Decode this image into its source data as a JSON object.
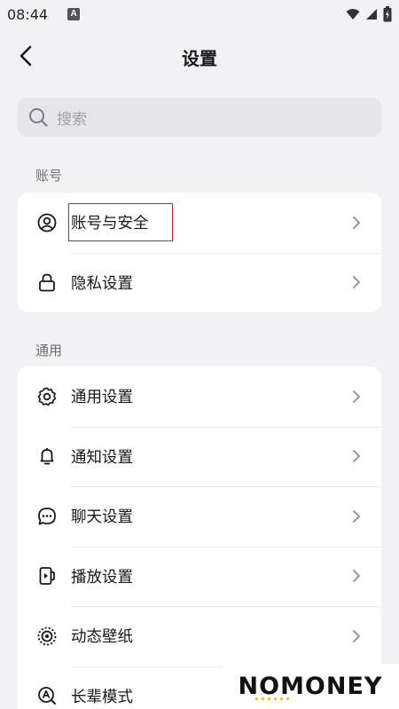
{
  "status_bar": {
    "time": "08:44",
    "notification_letter": "A"
  },
  "header": {
    "title": "设置"
  },
  "search": {
    "placeholder": "搜索"
  },
  "sections": [
    {
      "label": "账号",
      "items": [
        {
          "label": "账号与安全",
          "icon": "user-circle-icon"
        },
        {
          "label": "隐私设置",
          "icon": "lock-icon"
        }
      ]
    },
    {
      "label": "通用",
      "items": [
        {
          "label": "通用设置",
          "icon": "gear-icon"
        },
        {
          "label": "通知设置",
          "icon": "bell-icon"
        },
        {
          "label": "聊天设置",
          "icon": "chat-bubble-icon"
        },
        {
          "label": "播放设置",
          "icon": "play-phone-icon"
        },
        {
          "label": "动态壁纸",
          "icon": "wallpaper-icon"
        },
        {
          "label": "长辈模式",
          "icon": "elder-mode-icon"
        }
      ]
    }
  ],
  "watermark": {
    "text": "NOMONEY"
  },
  "colors": {
    "background": "#f2f2f4",
    "card": "#ffffff",
    "highlight": "#b8262c",
    "text": "#16181d",
    "secondary": "#6d6f75"
  }
}
